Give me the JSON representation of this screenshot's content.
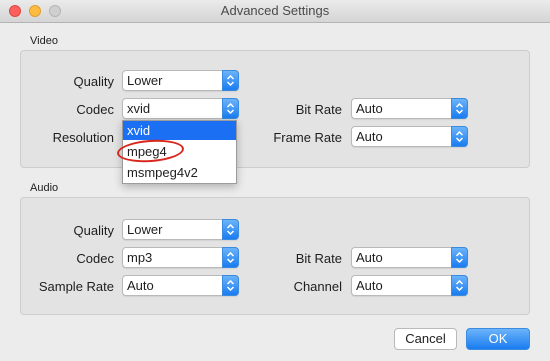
{
  "window": {
    "title": "Advanced Settings"
  },
  "video": {
    "section_label": "Video",
    "quality": {
      "label": "Quality",
      "value": "Lower"
    },
    "codec": {
      "label": "Codec",
      "value": "xvid"
    },
    "resolution": {
      "label": "Resolution"
    },
    "bit_rate": {
      "label": "Bit Rate",
      "value": "Auto"
    },
    "frame_rate": {
      "label": "Frame Rate",
      "value": "Auto"
    },
    "codec_dropdown": {
      "options": [
        "xvid",
        "mpeg4",
        "msmpeg4v2"
      ],
      "selected": "xvid",
      "highlighted_annotation": "mpeg4"
    }
  },
  "audio": {
    "section_label": "Audio",
    "quality": {
      "label": "Quality",
      "value": "Lower"
    },
    "codec": {
      "label": "Codec",
      "value": "mp3"
    },
    "sample_rate": {
      "label": "Sample Rate",
      "value": "Auto"
    },
    "bit_rate": {
      "label": "Bit Rate",
      "value": "Auto"
    },
    "channel": {
      "label": "Channel",
      "value": "Auto"
    }
  },
  "buttons": {
    "cancel": "Cancel",
    "ok": "OK"
  },
  "colors": {
    "accent": "#1b6ff3",
    "annotation": "#d9261c"
  }
}
